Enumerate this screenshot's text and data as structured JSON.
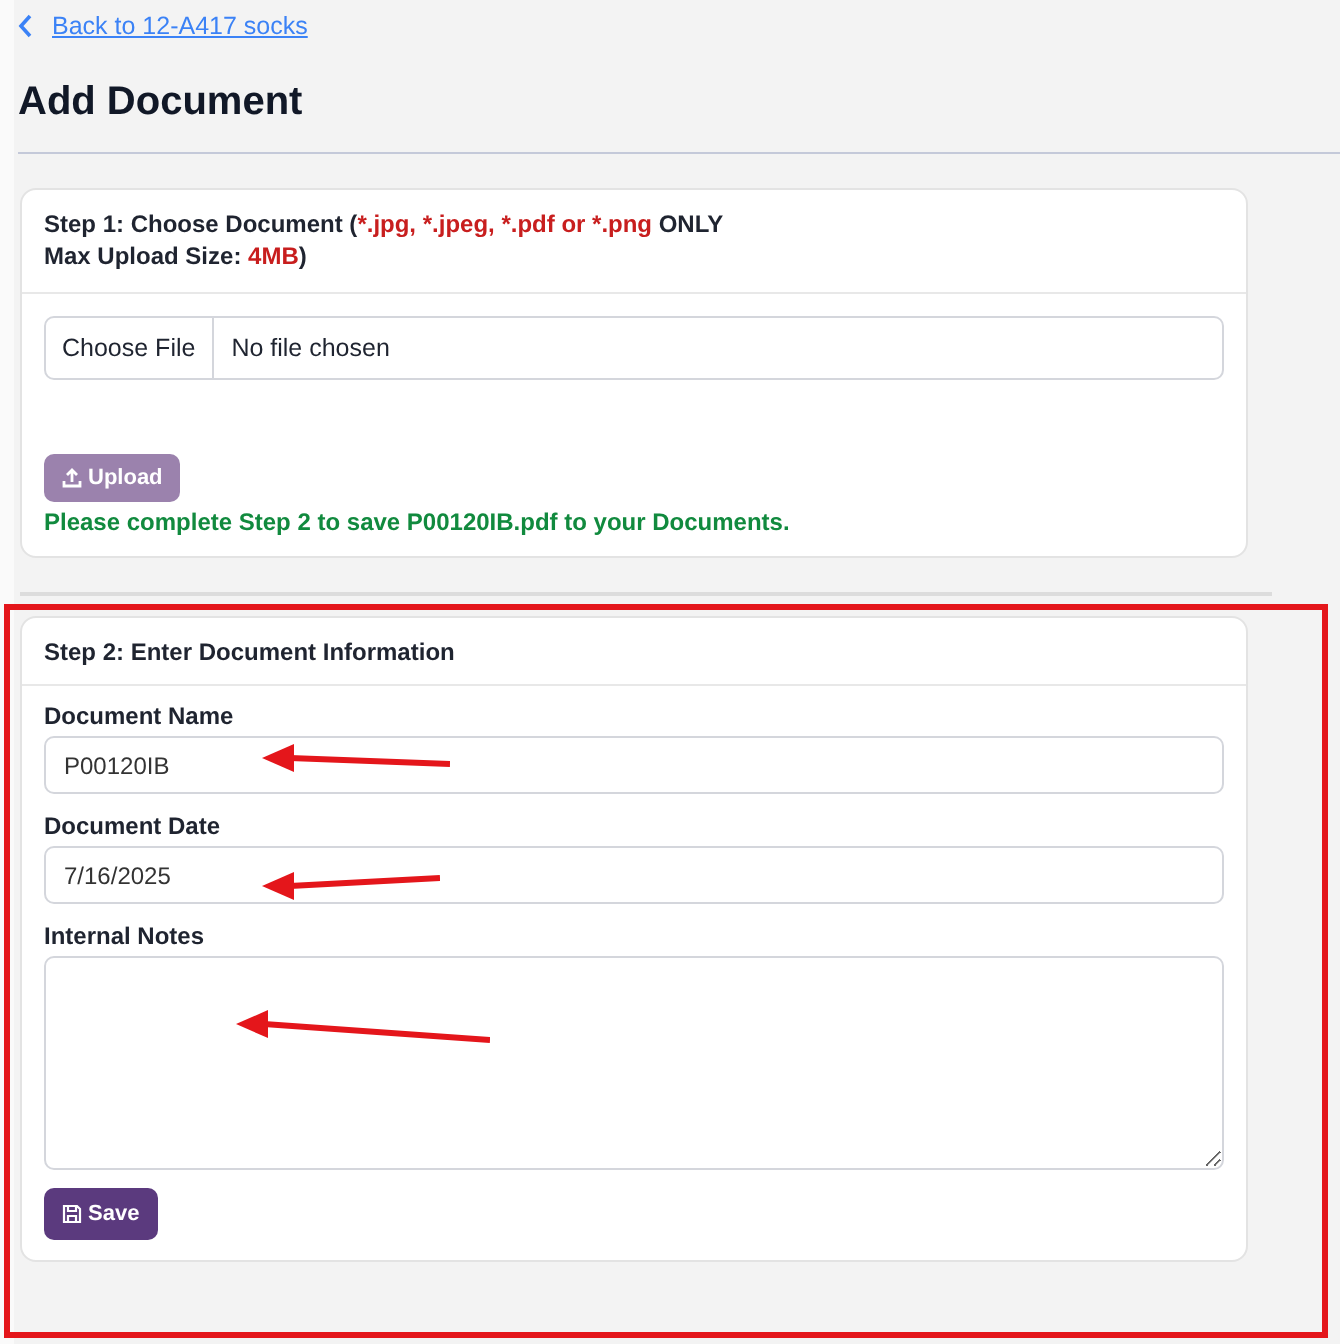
{
  "back_link": {
    "label": "Back to 12-A417 socks"
  },
  "title": "Add Document",
  "step1": {
    "heading_lines": [
      [
        {
          "text": "Step 1: Choose Document (",
          "highlight": false
        },
        {
          "text": "*.jpg, *.jpeg, *.pdf or *.png",
          "highlight": true
        },
        {
          "text": " ONLY",
          "highlight": false
        }
      ],
      [
        {
          "text": "Max Upload Size: ",
          "highlight": false
        },
        {
          "text": "4MB",
          "highlight": true
        },
        {
          "text": ")",
          "highlight": false
        }
      ]
    ],
    "file_button": "Choose File",
    "file_status": "No file chosen",
    "upload_button": {
      "label": "Upload",
      "disabled": true
    },
    "message": "Please complete Step 2 to save P00120IB.pdf to your Documents."
  },
  "step2": {
    "heading": "Step 2: Enter Document Information",
    "fields": [
      {
        "label": "Document Name",
        "kind": "input",
        "value": "P00120IB"
      },
      {
        "label": "Document Date",
        "kind": "input",
        "value": "7/16/2025"
      },
      {
        "label": "Internal Notes",
        "kind": "textarea"
      }
    ],
    "save_button": {
      "label": "Save",
      "disabled": false
    }
  }
}
